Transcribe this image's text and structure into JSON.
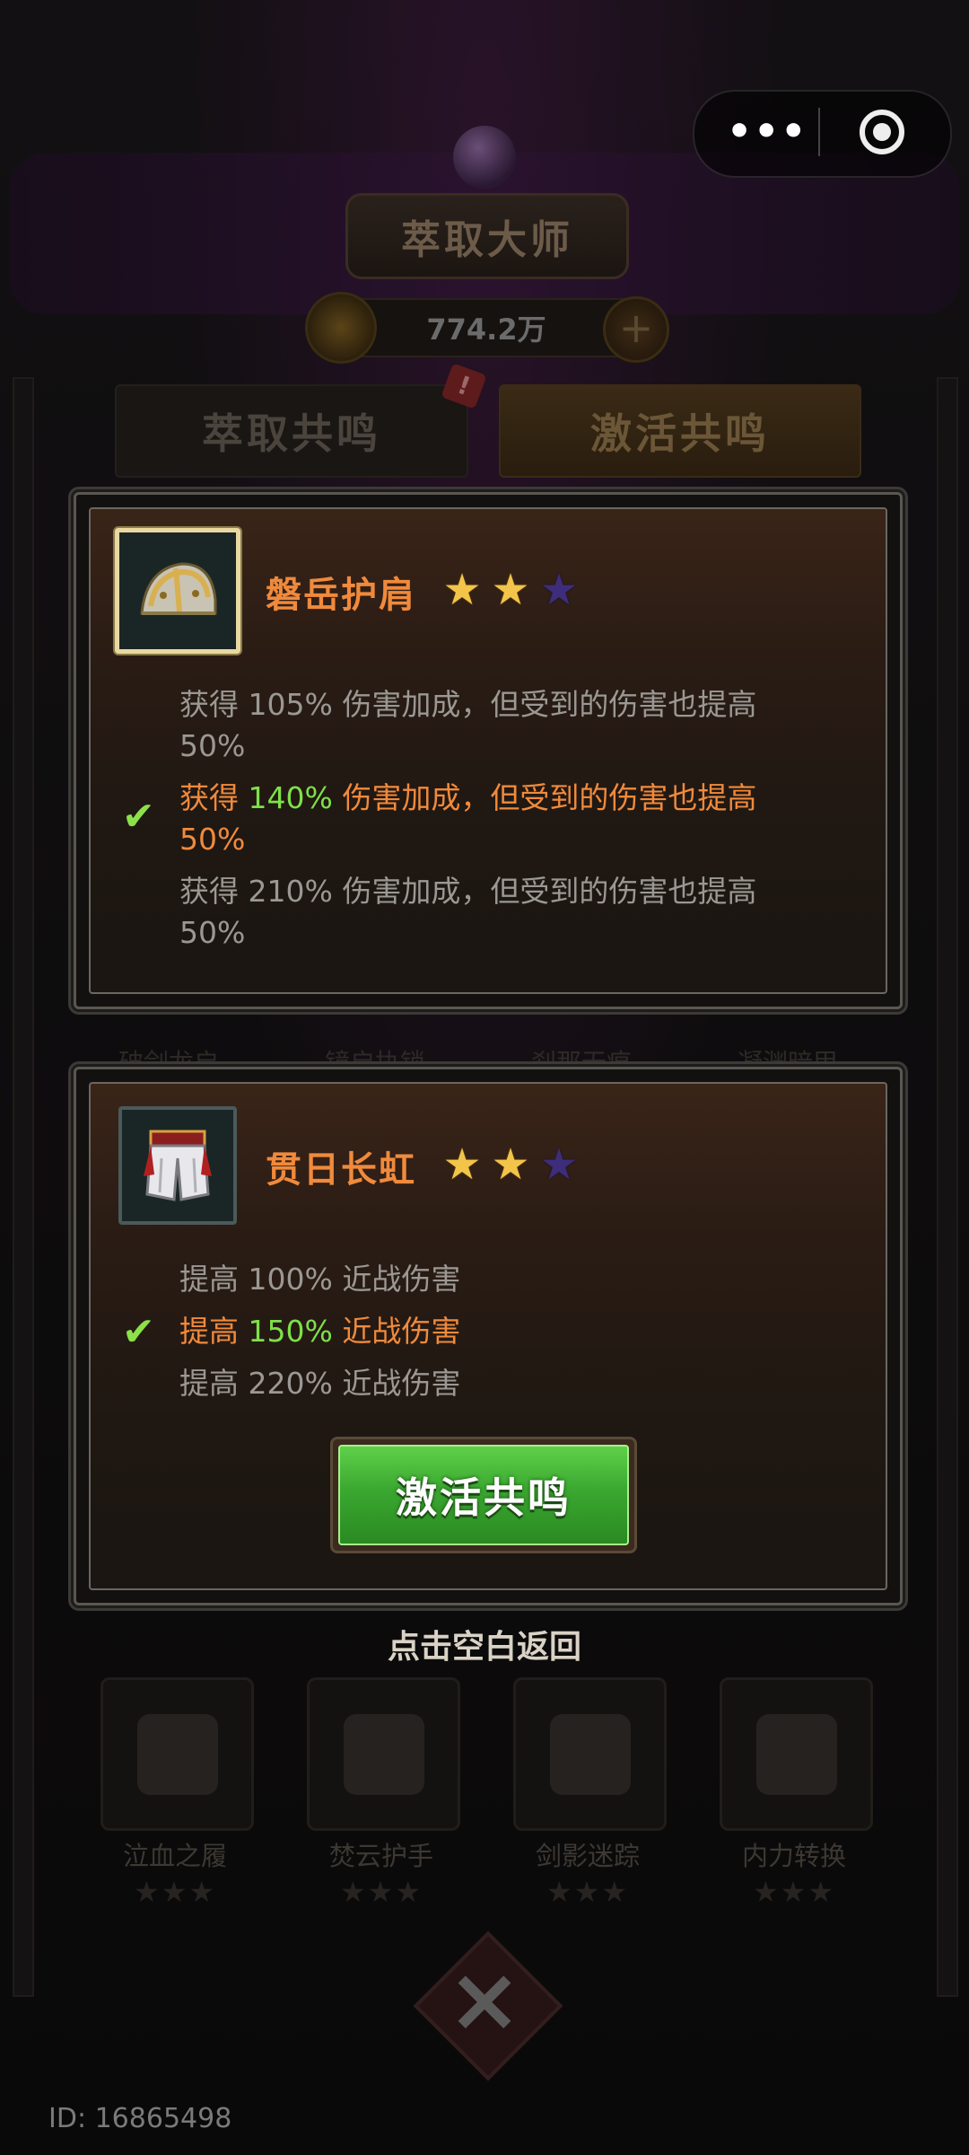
{
  "header": {
    "title": "萃取大师",
    "currency": "774.2万",
    "plus_symbol": "+"
  },
  "tabs": [
    {
      "label": "萃取共鸣",
      "badge": "!"
    },
    {
      "label": "激活共鸣"
    }
  ],
  "capsule": {
    "more_symbol": "•••"
  },
  "background_items": [
    {
      "name": "泣血之履",
      "stars_text": "★★★"
    },
    {
      "name": "焚云护手",
      "stars_text": "★★★"
    },
    {
      "name": "剑影迷踪",
      "stars_text": "★★★"
    },
    {
      "name": "内力转换",
      "stars_text": "★★★"
    }
  ],
  "background_upper_labels": [
    "破剑龙启",
    "镜启执锁",
    "刹那无痕",
    "凝渊暗甲"
  ],
  "panels": [
    {
      "name": "磐岳护肩",
      "stars_filled": 2,
      "stars_total": 3,
      "icon": "shoulder-armor-icon",
      "tiers": [
        {
          "verb": "获得",
          "value": "105%",
          "text": "伤害加成，但受到的伤害也提高",
          "tail": "50%",
          "active": false
        },
        {
          "verb": "获得",
          "value": "140%",
          "text": "伤害加成，但受到的伤害也提高",
          "tail": "50%",
          "active": true
        },
        {
          "verb": "获得",
          "value": "210%",
          "text": "伤害加成，但受到的伤害也提高",
          "tail": "50%",
          "active": false
        }
      ]
    },
    {
      "name": "贯日长虹",
      "stars_filled": 2,
      "stars_total": 3,
      "icon": "leg-armor-icon",
      "tiers": [
        {
          "verb": "提高",
          "value": "100%",
          "text": "近战伤害",
          "active": false
        },
        {
          "verb": "提高",
          "value": "150%",
          "text": "近战伤害",
          "active": true
        },
        {
          "verb": "提高",
          "value": "220%",
          "text": "近战伤害",
          "active": false
        }
      ],
      "button_label": "激活共鸣"
    }
  ],
  "check_symbol": "✔",
  "hint": "点击空白返回",
  "user_id": "ID: 16865498",
  "colors": {
    "name_orange": "#f08a3c",
    "value_green": "#7ee04a",
    "star_gold": "#f2c54a",
    "star_empty": "#3d2d7a",
    "button_green": "#3aa830"
  }
}
